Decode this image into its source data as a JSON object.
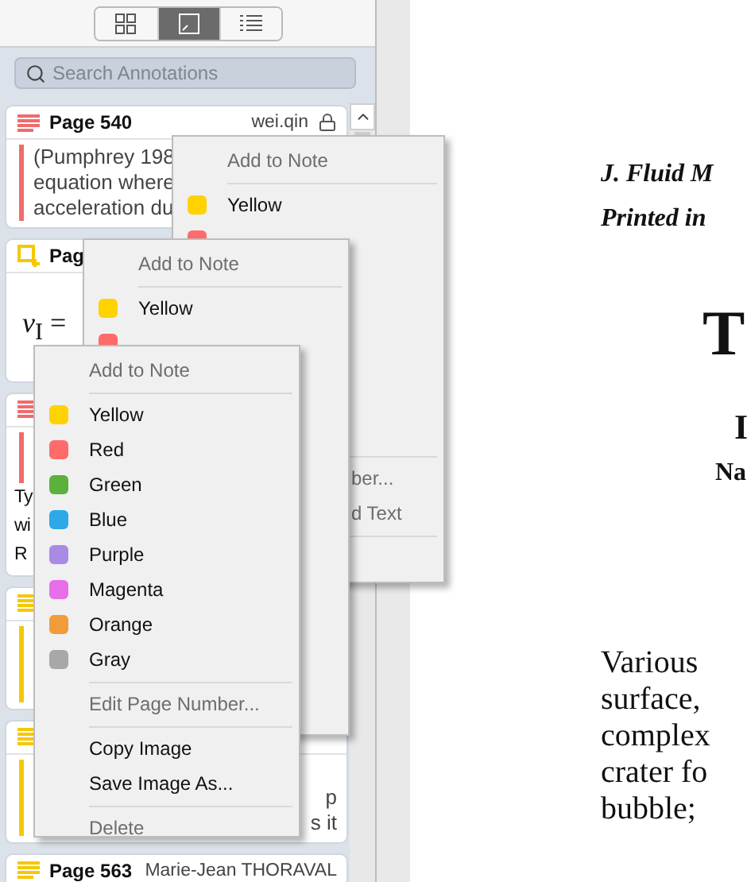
{
  "toolbar": {
    "segments": [
      {
        "kind": "thumbnails",
        "selected": false
      },
      {
        "kind": "annotations",
        "selected": true
      },
      {
        "kind": "outline",
        "selected": false
      }
    ]
  },
  "search": {
    "placeholder": "Search Annotations"
  },
  "cards": [
    {
      "kind": "highlight",
      "color": "#f06b6b",
      "page": "Page 540",
      "author": "wei.qin",
      "locked": true,
      "quote_lines": [
        {
          "text": "(Pumphrey 198"
        },
        {
          "text": "equation where"
        },
        {
          "text": "acceleration du"
        }
      ]
    },
    {
      "kind": "area",
      "color": "#f5c800",
      "page": "Pag",
      "math": "*v*$_{I}$ ="
    },
    {
      "kind": "highlight",
      "color": "#f06b6b",
      "note_lines": [
        "Ty",
        "wi",
        "R"
      ]
    },
    {
      "kind": "highlight",
      "color": "#f5c800"
    },
    {
      "kind": "highlight",
      "color": "#f5c800",
      "quote_lines": [
        {
          "end": "p"
        },
        {
          "end": "s it"
        }
      ]
    },
    {
      "kind": "highlight",
      "color": "#f5c800",
      "page": "Page 563",
      "author": "Marie-Jean THORAVAL"
    }
  ],
  "menus": [
    {
      "items": [
        {
          "kind": "header",
          "label": "Add to Note"
        },
        {
          "kind": "separator"
        },
        {
          "kind": "color",
          "label": "Yellow",
          "color": "#ffd200"
        },
        {
          "kind": "color",
          "color": "#ff6b6b"
        }
      ],
      "tail": [
        {
          "kind": "separator"
        },
        {
          "kind": "action",
          "label": "ber...",
          "disabled": true
        },
        {
          "kind": "action",
          "label": "d Text",
          "disabled": true
        },
        {
          "kind": "separator"
        }
      ]
    },
    {
      "items": [
        {
          "kind": "header",
          "label": "Add to Note"
        },
        {
          "kind": "separator"
        },
        {
          "kind": "color",
          "label": "Yellow",
          "color": "#ffd200"
        },
        {
          "kind": "color",
          "color": "#ff6b6b"
        }
      ]
    },
    {
      "items": [
        {
          "kind": "header",
          "label": "Add to Note"
        },
        {
          "kind": "separator"
        },
        {
          "kind": "color",
          "label": "Yellow",
          "color": "#ffd200"
        },
        {
          "kind": "color",
          "label": "Red",
          "color": "#ff6b6b"
        },
        {
          "kind": "color",
          "label": "Green",
          "color": "#5cb03c"
        },
        {
          "kind": "color",
          "label": "Blue",
          "color": "#2ea8e8"
        },
        {
          "kind": "color",
          "label": "Purple",
          "color": "#a98be6"
        },
        {
          "kind": "color",
          "label": "Magenta",
          "color": "#e86de8"
        },
        {
          "kind": "color",
          "label": "Orange",
          "color": "#f29b3a"
        },
        {
          "kind": "color",
          "label": "Gray",
          "color": "#a8a8a8"
        },
        {
          "kind": "separator"
        },
        {
          "kind": "action",
          "label": "Edit Page Number...",
          "disabled": true
        },
        {
          "kind": "separator"
        },
        {
          "kind": "action",
          "label": "Copy Image",
          "disabled": false
        },
        {
          "kind": "action",
          "label": "Save Image As...",
          "disabled": false
        },
        {
          "kind": "separator"
        },
        {
          "kind": "action",
          "label": "Delete",
          "disabled": true
        }
      ]
    }
  ],
  "document": {
    "header_lines": [
      "J. Fluid M",
      "Printed in"
    ],
    "title": "T",
    "author": "I",
    "affiliation": "Na",
    "body_lines": [
      "Various",
      "surface,",
      "complex",
      "crater fo",
      "bubble;"
    ]
  }
}
